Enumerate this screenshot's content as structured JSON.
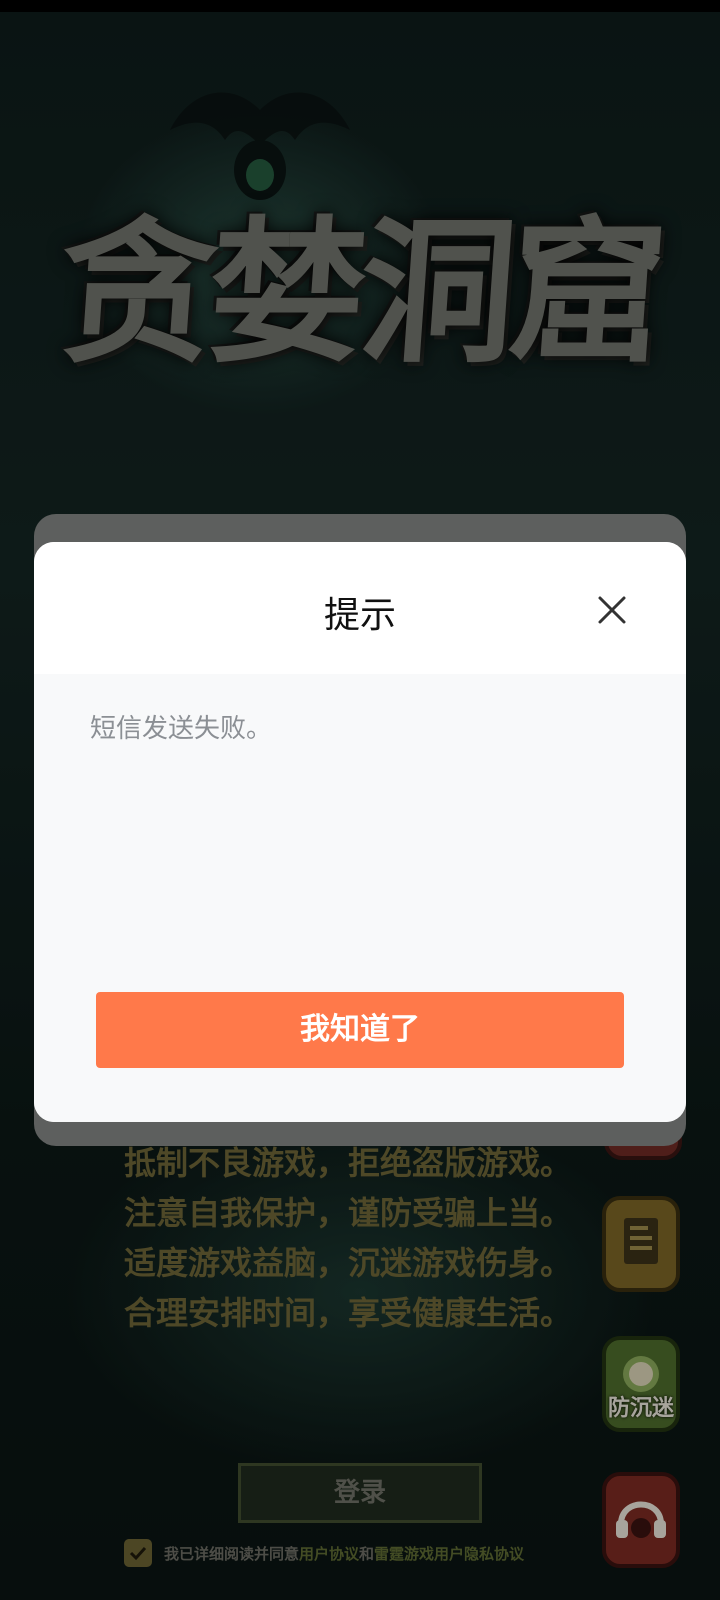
{
  "game": {
    "logo_text": "贪婪洞窟"
  },
  "notice_lines": [
    "抵制不良游戏，拒绝盗版游戏。",
    "注意自我保护，谨防受骗上当。",
    "适度游戏益脑，沉迷游戏伤身。",
    "合理安排时间，享受健康生活。"
  ],
  "side_buttons": {
    "anti_addiction_label": "防沉迷"
  },
  "login": {
    "button_label": "登录"
  },
  "agreement": {
    "prefix": "我已详细阅读并同意",
    "user_agreement": "用户协议",
    "and": "和",
    "privacy": "雷霆游戏用户隐私协议"
  },
  "dialog": {
    "title": "提示",
    "message": "短信发送失败。",
    "confirm_label": "我知道了"
  },
  "colors": {
    "accent": "#ff794a"
  }
}
